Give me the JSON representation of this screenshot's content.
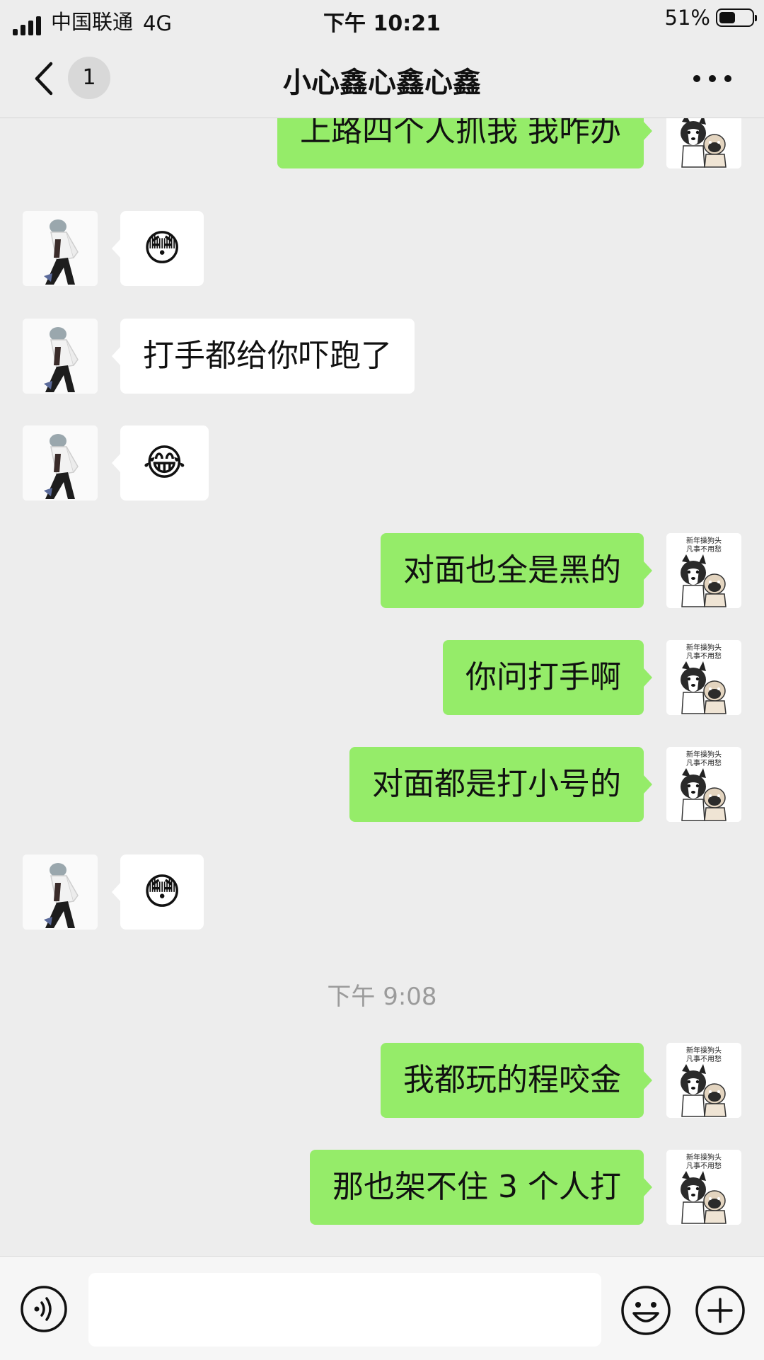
{
  "status_bar": {
    "carrier": "中国联通",
    "network": "4G",
    "time": "下午 10:21",
    "battery": "51%",
    "battery_level": 0.51
  },
  "header": {
    "unread_count": "1",
    "title": "小心鑫心鑫心鑫"
  },
  "messages": {
    "m1": "上路四个人抓我 我咋办",
    "m2": "😳",
    "m3": "打手都给你吓跑了",
    "m4": "😂",
    "m5": "对面也全是黑的",
    "m6": "你问打手啊",
    "m7": "对面都是打小号的",
    "m8": "😳",
    "timestamp": "下午 9:08",
    "m9": "我都玩的程咬金",
    "m10": "那也架不住 3 个人打"
  },
  "avatar_text": {
    "line1": "新年操狗头",
    "line2": "凡事不用愁"
  },
  "colors": {
    "background": "#ededed",
    "outgoing_bubble": "#95ec69",
    "incoming_bubble": "#ffffff",
    "timestamp": "#9b9b9b"
  }
}
